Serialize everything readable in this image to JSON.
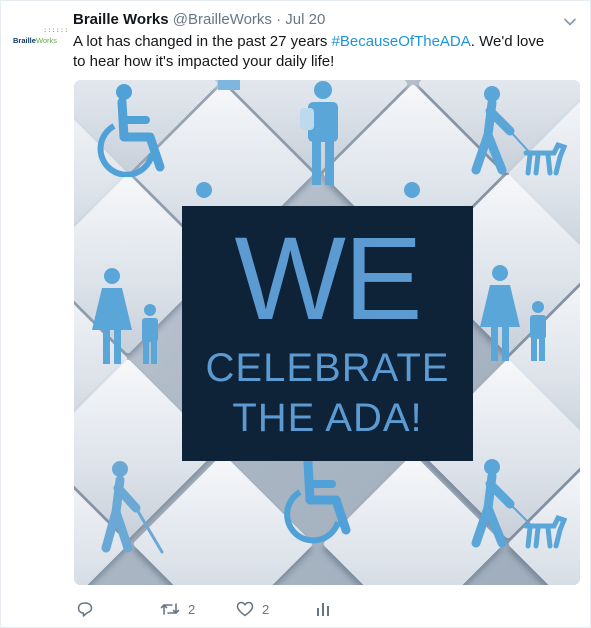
{
  "tweet": {
    "avatar": {
      "logo_bold": "Braille",
      "logo_light": "Works",
      "dots": "::::::"
    },
    "author_name": "Braille Works",
    "handle": "@BrailleWorks",
    "separator": "·",
    "date": "Jul 20",
    "text_before": "A lot has changed in the past 27 years ",
    "hashtag": "#BecauseOfTheADA",
    "text_after": ". We'd love to hear how it's impacted your daily life!",
    "image": {
      "line1": "WE",
      "line2": "CELEBRATE",
      "line3": "THE ADA!"
    },
    "actions": {
      "reply_count": "",
      "retweet_count": "2",
      "like_count": "2"
    }
  },
  "colors": {
    "accent": "#1b95e0",
    "muted": "#657786",
    "panel": "#0e2238",
    "panel_text": "#5b9bd2",
    "icon_blue": "#5aa6d8"
  },
  "icons": [
    "chevron-down-icon",
    "reply-icon",
    "retweet-icon",
    "like-icon",
    "analytics-icon"
  ]
}
